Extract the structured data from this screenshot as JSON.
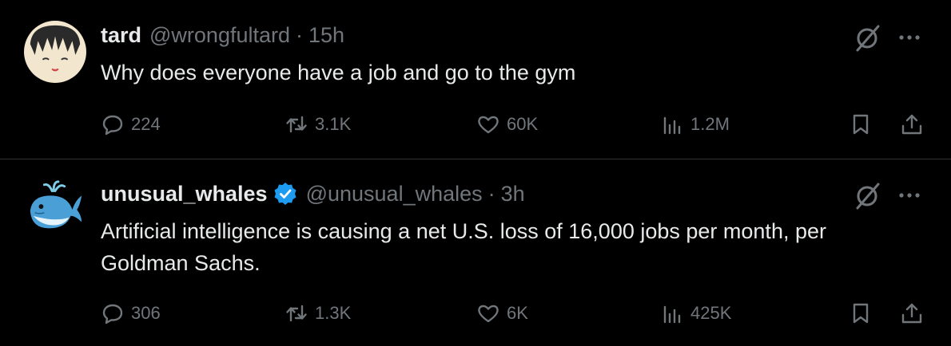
{
  "tweets": [
    {
      "name": "tard",
      "handle": "@wrongfultard",
      "separator": "·",
      "time": "15h",
      "text": "Why does everyone have a job and go to the gym",
      "verified": false,
      "avatar_icon": "anime-face-avatar",
      "replies": "224",
      "retweets": "3.1K",
      "likes": "60K",
      "views": "1.2M"
    },
    {
      "name": "unusual_whales",
      "handle": "@unusual_whales",
      "separator": "·",
      "time": "3h",
      "text": "Artificial intelligence is causing a net U.S. loss of 16,000 jobs per month, per Goldman Sachs.",
      "verified": true,
      "avatar_icon": "blue-whale-avatar",
      "replies": "306",
      "retweets": "1.3K",
      "likes": "6K",
      "views": "425K"
    }
  ],
  "colors": {
    "background": "#000000",
    "primary_text": "#e7e9ea",
    "secondary_text": "#71767b",
    "divider": "#2f3336",
    "verified": "#1d9bf0"
  }
}
